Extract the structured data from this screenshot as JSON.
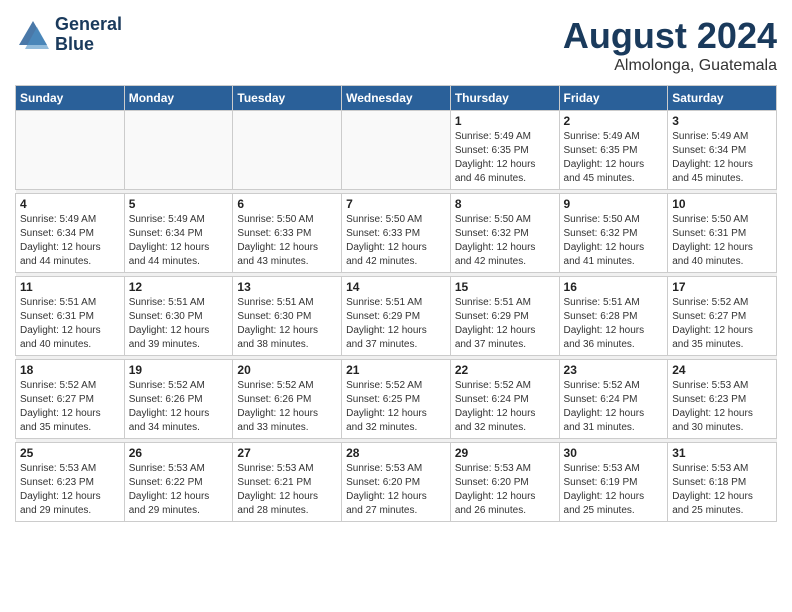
{
  "header": {
    "logo_line1": "General",
    "logo_line2": "Blue",
    "month": "August 2024",
    "location": "Almolonga, Guatemala"
  },
  "weekdays": [
    "Sunday",
    "Monday",
    "Tuesday",
    "Wednesday",
    "Thursday",
    "Friday",
    "Saturday"
  ],
  "weeks": [
    [
      {
        "day": "",
        "info": ""
      },
      {
        "day": "",
        "info": ""
      },
      {
        "day": "",
        "info": ""
      },
      {
        "day": "",
        "info": ""
      },
      {
        "day": "1",
        "info": "Sunrise: 5:49 AM\nSunset: 6:35 PM\nDaylight: 12 hours\nand 46 minutes."
      },
      {
        "day": "2",
        "info": "Sunrise: 5:49 AM\nSunset: 6:35 PM\nDaylight: 12 hours\nand 45 minutes."
      },
      {
        "day": "3",
        "info": "Sunrise: 5:49 AM\nSunset: 6:34 PM\nDaylight: 12 hours\nand 45 minutes."
      }
    ],
    [
      {
        "day": "4",
        "info": "Sunrise: 5:49 AM\nSunset: 6:34 PM\nDaylight: 12 hours\nand 44 minutes."
      },
      {
        "day": "5",
        "info": "Sunrise: 5:49 AM\nSunset: 6:34 PM\nDaylight: 12 hours\nand 44 minutes."
      },
      {
        "day": "6",
        "info": "Sunrise: 5:50 AM\nSunset: 6:33 PM\nDaylight: 12 hours\nand 43 minutes."
      },
      {
        "day": "7",
        "info": "Sunrise: 5:50 AM\nSunset: 6:33 PM\nDaylight: 12 hours\nand 42 minutes."
      },
      {
        "day": "8",
        "info": "Sunrise: 5:50 AM\nSunset: 6:32 PM\nDaylight: 12 hours\nand 42 minutes."
      },
      {
        "day": "9",
        "info": "Sunrise: 5:50 AM\nSunset: 6:32 PM\nDaylight: 12 hours\nand 41 minutes."
      },
      {
        "day": "10",
        "info": "Sunrise: 5:50 AM\nSunset: 6:31 PM\nDaylight: 12 hours\nand 40 minutes."
      }
    ],
    [
      {
        "day": "11",
        "info": "Sunrise: 5:51 AM\nSunset: 6:31 PM\nDaylight: 12 hours\nand 40 minutes."
      },
      {
        "day": "12",
        "info": "Sunrise: 5:51 AM\nSunset: 6:30 PM\nDaylight: 12 hours\nand 39 minutes."
      },
      {
        "day": "13",
        "info": "Sunrise: 5:51 AM\nSunset: 6:30 PM\nDaylight: 12 hours\nand 38 minutes."
      },
      {
        "day": "14",
        "info": "Sunrise: 5:51 AM\nSunset: 6:29 PM\nDaylight: 12 hours\nand 37 minutes."
      },
      {
        "day": "15",
        "info": "Sunrise: 5:51 AM\nSunset: 6:29 PM\nDaylight: 12 hours\nand 37 minutes."
      },
      {
        "day": "16",
        "info": "Sunrise: 5:51 AM\nSunset: 6:28 PM\nDaylight: 12 hours\nand 36 minutes."
      },
      {
        "day": "17",
        "info": "Sunrise: 5:52 AM\nSunset: 6:27 PM\nDaylight: 12 hours\nand 35 minutes."
      }
    ],
    [
      {
        "day": "18",
        "info": "Sunrise: 5:52 AM\nSunset: 6:27 PM\nDaylight: 12 hours\nand 35 minutes."
      },
      {
        "day": "19",
        "info": "Sunrise: 5:52 AM\nSunset: 6:26 PM\nDaylight: 12 hours\nand 34 minutes."
      },
      {
        "day": "20",
        "info": "Sunrise: 5:52 AM\nSunset: 6:26 PM\nDaylight: 12 hours\nand 33 minutes."
      },
      {
        "day": "21",
        "info": "Sunrise: 5:52 AM\nSunset: 6:25 PM\nDaylight: 12 hours\nand 32 minutes."
      },
      {
        "day": "22",
        "info": "Sunrise: 5:52 AM\nSunset: 6:24 PM\nDaylight: 12 hours\nand 32 minutes."
      },
      {
        "day": "23",
        "info": "Sunrise: 5:52 AM\nSunset: 6:24 PM\nDaylight: 12 hours\nand 31 minutes."
      },
      {
        "day": "24",
        "info": "Sunrise: 5:53 AM\nSunset: 6:23 PM\nDaylight: 12 hours\nand 30 minutes."
      }
    ],
    [
      {
        "day": "25",
        "info": "Sunrise: 5:53 AM\nSunset: 6:23 PM\nDaylight: 12 hours\nand 29 minutes."
      },
      {
        "day": "26",
        "info": "Sunrise: 5:53 AM\nSunset: 6:22 PM\nDaylight: 12 hours\nand 29 minutes."
      },
      {
        "day": "27",
        "info": "Sunrise: 5:53 AM\nSunset: 6:21 PM\nDaylight: 12 hours\nand 28 minutes."
      },
      {
        "day": "28",
        "info": "Sunrise: 5:53 AM\nSunset: 6:20 PM\nDaylight: 12 hours\nand 27 minutes."
      },
      {
        "day": "29",
        "info": "Sunrise: 5:53 AM\nSunset: 6:20 PM\nDaylight: 12 hours\nand 26 minutes."
      },
      {
        "day": "30",
        "info": "Sunrise: 5:53 AM\nSunset: 6:19 PM\nDaylight: 12 hours\nand 25 minutes."
      },
      {
        "day": "31",
        "info": "Sunrise: 5:53 AM\nSunset: 6:18 PM\nDaylight: 12 hours\nand 25 minutes."
      }
    ]
  ]
}
